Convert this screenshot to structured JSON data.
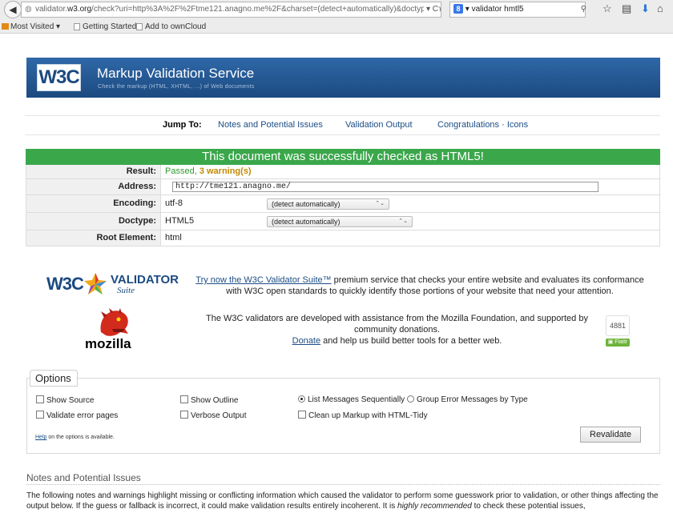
{
  "browser": {
    "url_scheme_host": "validator.",
    "url_host": "w3.org",
    "url_rest": "/check?uri=http%3A%2F%2Ftme121.anagno.me%2F&charset=(detect+automatically)&doctype=Inline&grou",
    "search_text": "validator hmtl5",
    "search_engine": "8"
  },
  "bookmarks": [
    {
      "label": "Most Visited ▾"
    },
    {
      "label": "Getting Started"
    },
    {
      "label": "Add to ownCloud"
    }
  ],
  "banner": {
    "logo": "W3C",
    "title": "Markup Validation Service",
    "subtitle": "Check the markup (HTML, XHTML, ...) of Web documents"
  },
  "jump": {
    "label": "Jump To:",
    "links": [
      "Notes and Potential Issues",
      "Validation Output",
      "Congratulations · Icons"
    ]
  },
  "result": {
    "banner": "This document was successfully checked as HTML5!",
    "result_label": "Result:",
    "result_passed": "Passed, ",
    "result_warnings": "3 warning(s)",
    "address_label": "Address:",
    "address_value": "http://tme121.anagno.me/",
    "encoding_label": "Encoding:",
    "encoding_value": "utf-8",
    "encoding_select": "(detect automatically)",
    "doctype_label": "Doctype:",
    "doctype_value": "HTML5",
    "doctype_select": "(detect automatically)",
    "root_label": "Root Element:",
    "root_value": "html"
  },
  "suite": {
    "logo_w3c": "W3C",
    "logo_word": "VALIDATOR",
    "logo_suite": "Suite",
    "promo_link": "Try now the W3C Validator Suite™",
    "promo_rest": " premium service that checks your entire website and evaluates its conformance with W3C open standards to quickly identify those portions of your website that need your attention."
  },
  "mozilla": {
    "word": "mozilla",
    "text": "The W3C validators are developed with assistance from the Mozilla Foundation, and supported by community donations.",
    "donate_link": "Donate",
    "donate_rest": " and help us build better tools for a better web.",
    "flattr_count": "4881",
    "flattr_label": "Flattr"
  },
  "options": {
    "legend": "Options",
    "show_source": "Show Source",
    "show_outline": "Show Outline",
    "list_sequential": "List Messages Sequentially",
    "group_by_type": "Group Error Messages by Type",
    "validate_error_pages": "Validate error pages",
    "verbose_output": "Verbose Output",
    "clean_up_tidy": "Clean up Markup with HTML-Tidy",
    "help_link": "Help",
    "help_rest": " on the options is available.",
    "revalidate": "Revalidate"
  },
  "notes": {
    "heading": "Notes and Potential Issues",
    "body_1": "The following notes and warnings highlight missing or conflicting information which caused the validator to perform some guesswork prior to validation, or other things affecting the output below. If the guess or fallback is incorrect, it could make validation results entirely incoherent. It is ",
    "body_em": "highly recommended",
    "body_2": " to check these potential issues,"
  },
  "colors": {
    "banner_blue": "#22538a",
    "success_green": "#3aa74b",
    "warning_amber": "#c38a00",
    "link_blue": "#1b4d85"
  }
}
